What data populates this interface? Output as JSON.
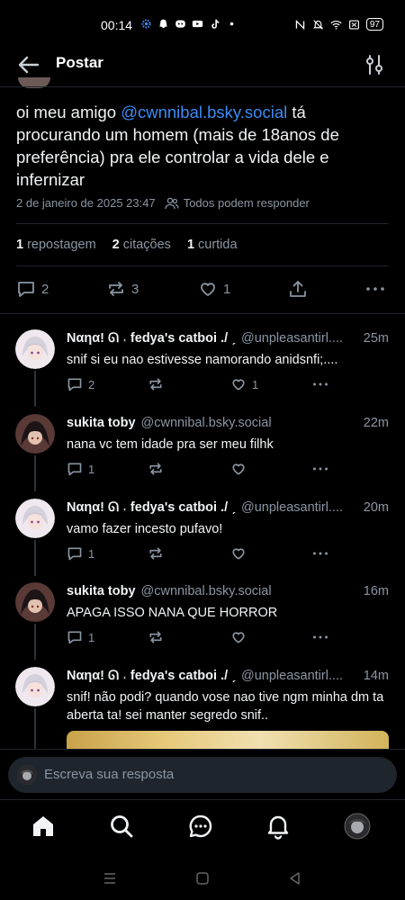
{
  "status_bar": {
    "time": "00:14",
    "battery": "97",
    "left_icons": [
      "settings-icon",
      "snapchat-icon",
      "discord-icon",
      "youtube-icon",
      "tiktok-icon",
      "dot-icon"
    ],
    "right_icons": [
      "nfc-icon",
      "mute-icon",
      "wifi-icon",
      "sim-icon",
      "battery-icon"
    ]
  },
  "header": {
    "title": "Postar"
  },
  "post": {
    "text_before": "oi meu amigo ",
    "mention": "@cwnnibal.bsky.social",
    "text_after": " tá procurando um homem (mais de 18anos de preferência) pra ele controlar a vida dele e infernizar",
    "timestamp": "2 de janeiro de 2025 23:47",
    "reply_setting": "Todos podem responder",
    "stats": {
      "reposts_count": "1",
      "reposts_label": "repostagem",
      "quotes_count": "2",
      "quotes_label": "citações",
      "likes_count": "1",
      "likes_label": "curtida"
    },
    "actions": {
      "reply_count": "2",
      "repost_count": "3",
      "like_count": "1"
    }
  },
  "replies": [
    {
      "name": "Nαηα! ᘏ ˓ fedya's catboi ./ ˏ",
      "handle": "@unpleasantirl....",
      "time": "25m",
      "text": "snif si eu nao estivesse namorando anidsnfi;....",
      "reply_count": "2",
      "repost_count": "",
      "like_count": "1",
      "avatar": "white-hair"
    },
    {
      "name": "sukita toby",
      "handle": "@cwnnibal.bsky.social",
      "time": "22m",
      "text": "nana vc tem idade pra ser meu filhk",
      "reply_count": "1",
      "repost_count": "",
      "like_count": "",
      "avatar": "dark-hair"
    },
    {
      "name": "Nαηα! ᘏ ˓ fedya's catboi ./ ˏ",
      "handle": "@unpleasantirl....",
      "time": "20m",
      "text": "vamo fazer incesto pufavo!",
      "reply_count": "1",
      "repost_count": "",
      "like_count": "",
      "avatar": "white-hair"
    },
    {
      "name": "sukita toby",
      "handle": "@cwnnibal.bsky.social",
      "time": "16m",
      "text": "APAGA ISSO NANA QUE HORROR",
      "reply_count": "1",
      "repost_count": "",
      "like_count": "",
      "avatar": "dark-hair"
    },
    {
      "name": "Nαηα! ᘏ ˓ fedya's catboi ./ ˏ",
      "handle": "@unpleasantirl....",
      "time": "14m",
      "text": "snif! não podi? quando vose nao tive ngm minha dm ta aberta ta! sei manter segredo snif..",
      "avatar": "white-hair"
    }
  ],
  "compose": {
    "placeholder": "Escreva sua resposta"
  },
  "bottom_nav": [
    "home-icon",
    "search-icon",
    "chat-icon",
    "notifications-icon",
    "profile-avatar"
  ],
  "colors": {
    "background": "#000000",
    "accent": "#3c8cf5",
    "muted": "#8a96a3",
    "divider": "#1e252c"
  }
}
